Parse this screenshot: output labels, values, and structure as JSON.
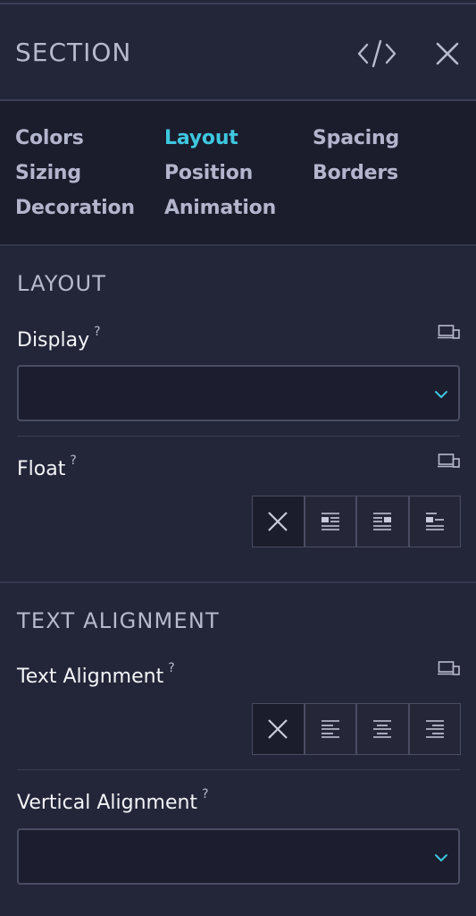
{
  "panel": {
    "title": "SECTION"
  },
  "tabs": [
    {
      "label": "Colors",
      "active": false
    },
    {
      "label": "Layout",
      "active": true
    },
    {
      "label": "Spacing",
      "active": false
    },
    {
      "label": "Sizing",
      "active": false
    },
    {
      "label": "Position",
      "active": false
    },
    {
      "label": "Borders",
      "active": false
    },
    {
      "label": "Decoration",
      "active": false
    },
    {
      "label": "Animation",
      "active": false
    }
  ],
  "layout_section": {
    "heading": "LAYOUT",
    "display": {
      "label": "Display",
      "help": "?",
      "value": ""
    },
    "float": {
      "label": "Float",
      "help": "?",
      "selected": "none",
      "options": [
        "none-icon",
        "float-left-icon",
        "float-right-icon",
        "float-left-alt-icon"
      ]
    }
  },
  "text_alignment_section": {
    "heading": "TEXT ALIGNMENT",
    "text_alignment": {
      "label": "Text Alignment",
      "help": "?",
      "selected": "none",
      "options": [
        "none-icon",
        "align-left-icon",
        "align-center-icon",
        "align-right-icon"
      ]
    },
    "vertical_alignment": {
      "label": "Vertical Alignment",
      "help": "?",
      "value": ""
    }
  },
  "colors": {
    "accent": "#3ec7e0",
    "background": "#232539",
    "tabs_background": "#1b1c2c"
  }
}
